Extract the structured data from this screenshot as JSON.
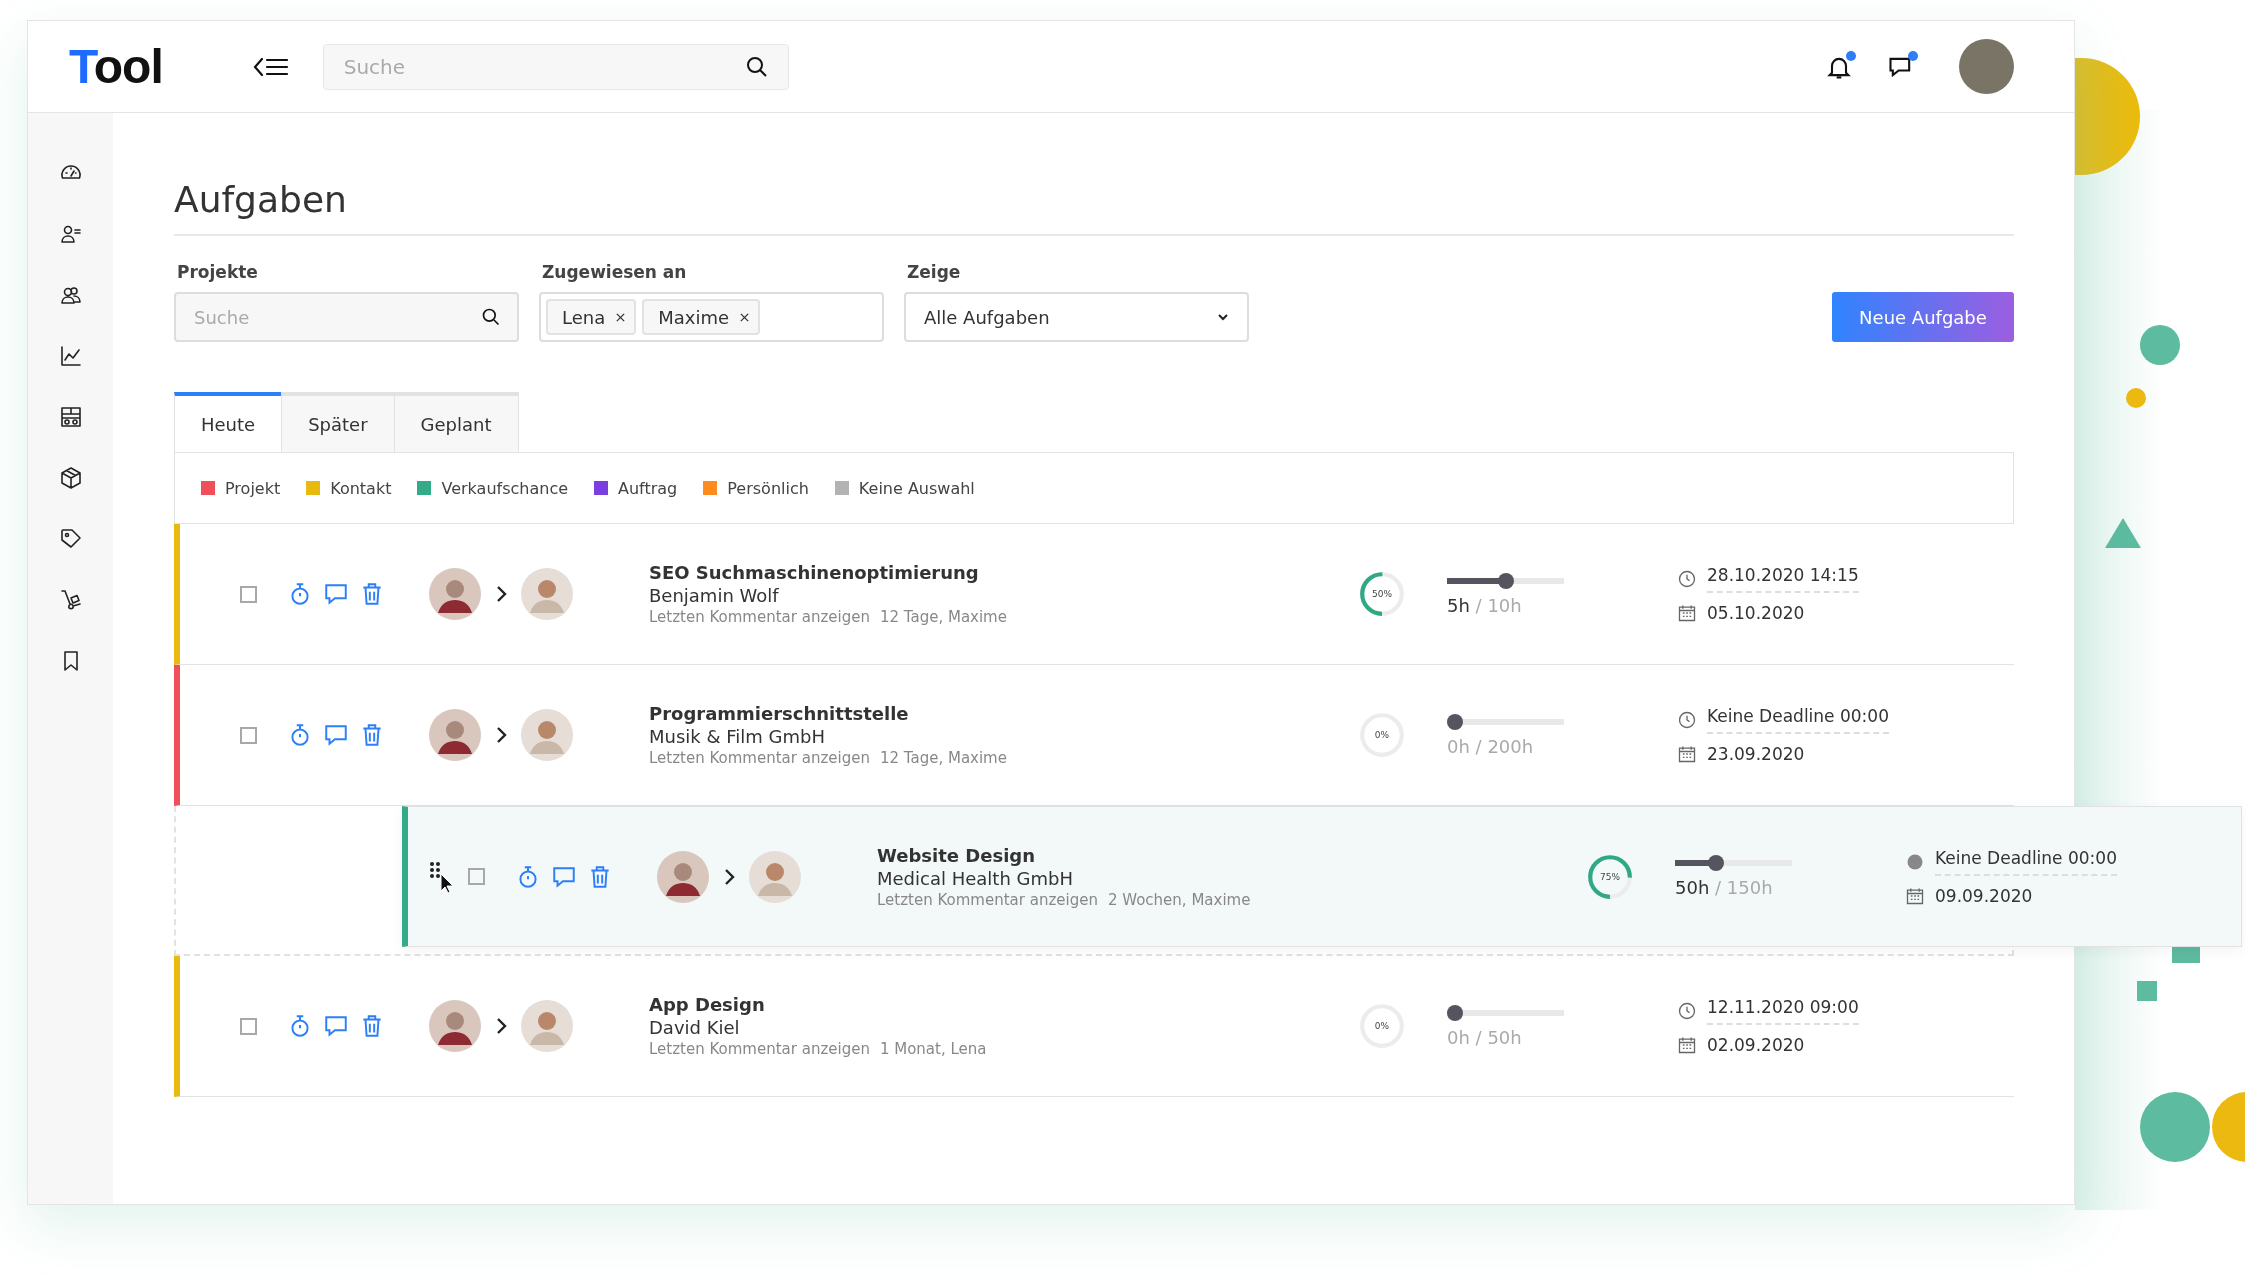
{
  "header": {
    "logo": "Tool",
    "search": {
      "placeholder": "Suche"
    },
    "notifications": {
      "unread": true
    },
    "messages": {
      "unread": true
    }
  },
  "sidebar": {
    "items": [
      {
        "kind": "gauge",
        "selected": false
      },
      {
        "kind": "contacts",
        "selected": false
      },
      {
        "kind": "people",
        "selected": false
      },
      {
        "kind": "chart",
        "selected": false
      },
      {
        "kind": "grid",
        "selected": false
      },
      {
        "kind": "cube",
        "selected": false
      },
      {
        "kind": "tag",
        "selected": false
      },
      {
        "kind": "truck",
        "selected": false
      },
      {
        "kind": "bookmark",
        "selected": false
      }
    ]
  },
  "page_title": "Aufgaben",
  "filters": {
    "projects": {
      "label": "Projekte",
      "placeholder": "Suche"
    },
    "assigned": {
      "label": "Zugewiesen an",
      "chips": [
        "Lena",
        "Maxime"
      ]
    },
    "show": {
      "label": "Zeige",
      "value": "Alle Aufgaben"
    },
    "new_button": "Neue Aufgabe"
  },
  "tabs": [
    {
      "label": "Heute",
      "selected": true
    },
    {
      "label": "Später",
      "selected": false
    },
    {
      "label": "Geplant",
      "selected": false
    }
  ],
  "legend": [
    {
      "label": "Projekt",
      "color": "#ef4f59"
    },
    {
      "label": "Kontakt",
      "color": "#e8b90e"
    },
    {
      "label": "Verkaufschance",
      "color": "#33ab88"
    },
    {
      "label": "Auftrag",
      "color": "#7b3fe0"
    },
    {
      "label": "Persönlich",
      "color": "#ff8a1e"
    },
    {
      "label": "Keine Auswahl",
      "color": "#b3b3b3"
    }
  ],
  "tasks": [
    {
      "color": "#e8b90e",
      "dragging": false,
      "checked": false,
      "title": "SEO Suchmaschinenoptimierung",
      "subtitle": "Benjamin Wolf",
      "comment_link": "Letzten Kommentar anzeigen",
      "comment_meta": "12 Tage, Maxime",
      "progress": {
        "level": 0.5,
        "label": "50%"
      },
      "hours": {
        "level": 0.5,
        "done": "5h",
        "total": "/ 10h"
      },
      "deadline": {
        "kind": "clock",
        "text": "28.10.2020 14:15"
      },
      "date": "05.10.2020"
    },
    {
      "color": "#ef4f59",
      "dragging": false,
      "checked": false,
      "title": "Programmierschnittstelle",
      "subtitle": "Musik & Film GmbH",
      "comment_link": "Letzten Kommentar anzeigen",
      "comment_meta": "12 Tage, Maxime",
      "progress": {
        "level": 0,
        "label": "0%"
      },
      "hours": {
        "level": 0,
        "done": "0h",
        "total": "/ 200h"
      },
      "deadline": {
        "kind": "clock",
        "text": "Keine Deadline 00:00"
      },
      "date": "23.09.2020"
    },
    {
      "color": "#33ab88",
      "dragging": true,
      "checked": false,
      "title": "Website Design",
      "subtitle": "Medical Health GmbH",
      "comment_link": "Letzten Kommentar anzeigen",
      "comment_meta": "2 Wochen, Maxime",
      "progress": {
        "level": 0.75,
        "label": "75%"
      },
      "hours": {
        "level": 0.33,
        "done": "50h",
        "total": "/ 150h"
      },
      "deadline": {
        "kind": "dot",
        "text": "Keine Deadline 00:00"
      },
      "date": "09.09.2020"
    },
    {
      "color": "#e8b90e",
      "dragging": false,
      "checked": false,
      "title": "App Design",
      "subtitle": "David Kiel",
      "comment_link": "Letzten Kommentar anzeigen",
      "comment_meta": "1 Monat, Lena",
      "progress": {
        "level": 0,
        "label": "0%"
      },
      "hours": {
        "level": 0,
        "done": "0h",
        "total": "/ 50h"
      },
      "deadline": {
        "kind": "clock",
        "text": "12.11.2020 09:00"
      },
      "date": "02.09.2020"
    }
  ]
}
